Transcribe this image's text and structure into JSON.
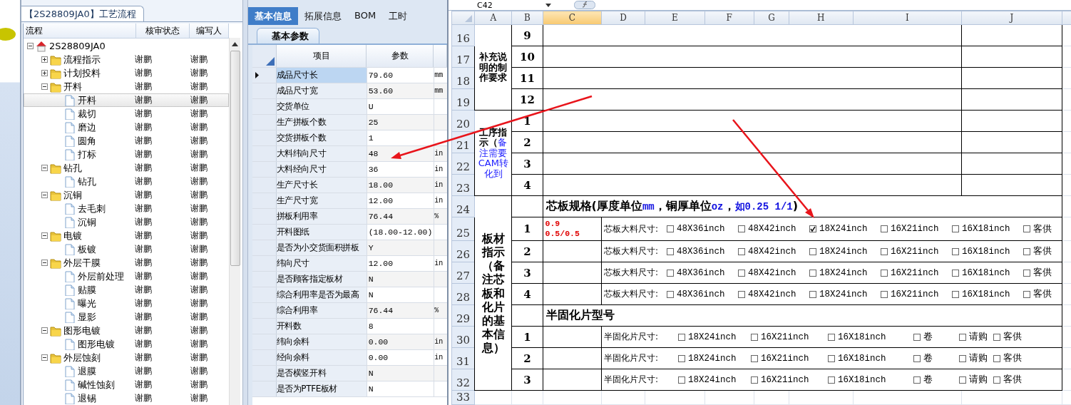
{
  "left_panel": {
    "tab": "【2S28809JA0】工艺流程",
    "columns": [
      "流程",
      "核审状态",
      "编写人"
    ],
    "tree": [
      {
        "label": "2S28809JA0",
        "kind": "root",
        "expanded": true,
        "selected": false,
        "children": [
          {
            "label": "流程指示",
            "kind": "folder",
            "expanded": false,
            "selected": false,
            "status": "谢鹏",
            "author": "谢鹏"
          },
          {
            "label": "计划投料",
            "kind": "folder",
            "expanded": false,
            "selected": false,
            "status": "谢鹏",
            "author": "谢鹏"
          },
          {
            "label": "开料",
            "kind": "folder",
            "expanded": true,
            "selected": false,
            "status": "谢鹏",
            "author": "谢鹏",
            "children": [
              {
                "label": "开料",
                "kind": "file",
                "selected": true,
                "status": "谢鹏",
                "author": "谢鹏"
              },
              {
                "label": "裁切",
                "kind": "file",
                "selected": false,
                "status": "谢鹏",
                "author": "谢鹏"
              },
              {
                "label": "磨边",
                "kind": "file",
                "selected": false,
                "status": "谢鹏",
                "author": "谢鹏"
              },
              {
                "label": "圆角",
                "kind": "file",
                "selected": false,
                "status": "谢鹏",
                "author": "谢鹏"
              },
              {
                "label": "打标",
                "kind": "file",
                "selected": false,
                "status": "谢鹏",
                "author": "谢鹏"
              }
            ]
          },
          {
            "label": "钻孔",
            "kind": "folder",
            "expanded": true,
            "selected": false,
            "status": "谢鹏",
            "author": "谢鹏",
            "children": [
              {
                "label": "钻孔",
                "kind": "file",
                "selected": false,
                "status": "谢鹏",
                "author": "谢鹏"
              }
            ]
          },
          {
            "label": "沉铜",
            "kind": "folder",
            "expanded": true,
            "selected": false,
            "status": "谢鹏",
            "author": "谢鹏",
            "children": [
              {
                "label": "去毛刺",
                "kind": "file",
                "selected": false,
                "status": "谢鹏",
                "author": "谢鹏"
              },
              {
                "label": "沉铜",
                "kind": "file",
                "selected": false,
                "status": "谢鹏",
                "author": "谢鹏"
              }
            ]
          },
          {
            "label": "电镀",
            "kind": "folder",
            "expanded": true,
            "selected": false,
            "status": "谢鹏",
            "author": "谢鹏",
            "children": [
              {
                "label": "板镀",
                "kind": "file",
                "selected": false,
                "status": "谢鹏",
                "author": "谢鹏"
              }
            ]
          },
          {
            "label": "外层干膜",
            "kind": "folder",
            "expanded": true,
            "selected": false,
            "status": "谢鹏",
            "author": "谢鹏",
            "children": [
              {
                "label": "外层前处理",
                "kind": "file",
                "selected": false,
                "status": "谢鹏",
                "author": "谢鹏"
              },
              {
                "label": "贴膜",
                "kind": "file",
                "selected": false,
                "status": "谢鹏",
                "author": "谢鹏"
              },
              {
                "label": "曝光",
                "kind": "file",
                "selected": false,
                "status": "谢鹏",
                "author": "谢鹏"
              },
              {
                "label": "显影",
                "kind": "file",
                "selected": false,
                "status": "谢鹏",
                "author": "谢鹏"
              }
            ]
          },
          {
            "label": "图形电镀",
            "kind": "folder",
            "expanded": true,
            "selected": false,
            "status": "谢鹏",
            "author": "谢鹏",
            "children": [
              {
                "label": "图形电镀",
                "kind": "file",
                "selected": false,
                "status": "谢鹏",
                "author": "谢鹏"
              }
            ]
          },
          {
            "label": "外层蚀刻",
            "kind": "folder",
            "expanded": true,
            "selected": false,
            "status": "谢鹏",
            "author": "谢鹏",
            "children": [
              {
                "label": "退膜",
                "kind": "file",
                "selected": false,
                "status": "谢鹏",
                "author": "谢鹏"
              },
              {
                "label": "碱性蚀刻",
                "kind": "file",
                "selected": false,
                "status": "谢鹏",
                "author": "谢鹏"
              },
              {
                "label": "退锡",
                "kind": "file",
                "selected": false,
                "status": "谢鹏",
                "author": "谢鹏"
              }
            ]
          }
        ]
      }
    ]
  },
  "middle_panel": {
    "tabs": [
      {
        "label": "基本信息",
        "selected": true
      },
      {
        "label": "拓展信息",
        "selected": false
      },
      {
        "label": "BOM",
        "selected": false
      },
      {
        "label": "工时",
        "selected": false
      }
    ],
    "subtab": "基本参数",
    "columns": [
      "项目",
      "参数"
    ],
    "rows": [
      {
        "item": "成品尺寸长",
        "value": "79.60",
        "unit": "mm",
        "selected": true
      },
      {
        "item": "成品尺寸宽",
        "value": "53.60",
        "unit": "mm",
        "selected": false
      },
      {
        "item": "交货单位",
        "value": "U",
        "selected": false
      },
      {
        "item": "生产拼板个数",
        "value": "25",
        "selected": false
      },
      {
        "item": "交货拼板个数",
        "value": "1",
        "selected": false
      },
      {
        "item": "大料纬向尺寸",
        "value": "48",
        "unit": "in",
        "selected": false
      },
      {
        "item": "大料经向尺寸",
        "value": "36",
        "unit": "in",
        "selected": false
      },
      {
        "item": "生产尺寸长",
        "value": "18.00",
        "unit": "in",
        "selected": false
      },
      {
        "item": "生产尺寸宽",
        "value": "12.00",
        "unit": "in",
        "selected": false
      },
      {
        "item": "拼板利用率",
        "value": "76.44",
        "unit": "%",
        "selected": false
      },
      {
        "item": "开料图纸",
        "value": "(18.00-12.00)",
        "selected": false
      },
      {
        "item": "是否为小交货面积拼板",
        "value": "Y",
        "selected": false
      },
      {
        "item": "纬向尺寸",
        "value": "12.00",
        "unit": "in",
        "selected": false
      },
      {
        "item": "是否顾客指定板材",
        "value": "N",
        "selected": false
      },
      {
        "item": "综合利用率是否为最高",
        "value": "N",
        "selected": false
      },
      {
        "item": "综合利用率",
        "value": "76.44",
        "unit": "%",
        "selected": false
      },
      {
        "item": "开料数",
        "value": "8",
        "selected": false
      },
      {
        "item": "纬向余料",
        "value": "0.00",
        "unit": "in",
        "selected": false
      },
      {
        "item": "经向余料",
        "value": "0.00",
        "unit": "in",
        "selected": false
      },
      {
        "item": "是否横竖开料",
        "value": "N",
        "selected": false
      },
      {
        "item": "是否为PTFE板材",
        "value": "N",
        "selected": false
      }
    ]
  },
  "sheet": {
    "name_box": "C42",
    "columns": [
      {
        "label": "A",
        "selected": false
      },
      {
        "label": "B",
        "selected": false
      },
      {
        "label": "C",
        "selected": true
      },
      {
        "label": "D",
        "selected": false
      },
      {
        "label": "E",
        "selected": false
      },
      {
        "label": "F",
        "selected": false
      },
      {
        "label": "G",
        "selected": false
      },
      {
        "label": "H",
        "selected": false
      },
      {
        "label": "I",
        "selected": false
      },
      {
        "label": "J",
        "selected": false
      }
    ],
    "sections": [
      {
        "kind": "notes",
        "label": "补充说明的制作要求",
        "rows": [
          {
            "row": "16",
            "num": "9"
          },
          {
            "row": "17",
            "num": "10"
          },
          {
            "row": "18",
            "num": "11"
          },
          {
            "row": "19",
            "num": "12"
          }
        ]
      },
      {
        "kind": "notes",
        "label": "工序指示（",
        "note": "备注需要CAM转化到",
        "rows": [
          {
            "row": "20",
            "num": "1"
          },
          {
            "row": "21",
            "num": "2"
          },
          {
            "row": "22",
            "num": "3"
          },
          {
            "row": "23",
            "num": "4"
          }
        ]
      },
      {
        "kind": "material",
        "label": "板材指示（备注芯板和化片的基本信息）",
        "rows": [
          {
            "kind": "title",
            "row": "24",
            "segments": [
              {
                "text": "芯板规格(厚度单位",
                "kind": "plain"
              },
              {
                "text": "mm",
                "kind": "note"
              },
              {
                "text": "，铜厚单位",
                "kind": "plain"
              },
              {
                "text": "oz",
                "kind": "note"
              },
              {
                "text": "，",
                "kind": "plain"
              },
              {
                "text": "如0.25 1/1",
                "kind": "note"
              },
              {
                "text": ")",
                "kind": "plain"
              }
            ]
          },
          {
            "kind": "core",
            "row": "25",
            "num": "1",
            "spec": [
              "0.9",
              "0.5/0.5"
            ],
            "field": "芯板大料尺寸:",
            "options": [
              {
                "label": "48X36inch",
                "checked": false
              },
              {
                "label": "48X42inch",
                "checked": false
              },
              {
                "label": "18X24inch",
                "checked": true
              },
              {
                "label": "16X21inch",
                "checked": false
              },
              {
                "label": "16X18inch",
                "checked": false
              },
              {
                "label": "客供",
                "checked": false
              }
            ]
          },
          {
            "kind": "core",
            "row": "26",
            "num": "2",
            "field": "芯板大料尺寸:",
            "options": [
              {
                "label": "48X36inch",
                "checked": false
              },
              {
                "label": "48X42inch",
                "checked": false
              },
              {
                "label": "18X24inch",
                "checked": false
              },
              {
                "label": "16X21inch",
                "checked": false
              },
              {
                "label": "16X18inch",
                "checked": false
              },
              {
                "label": "客供",
                "checked": false
              }
            ]
          },
          {
            "kind": "core",
            "row": "27",
            "num": "3",
            "field": "芯板大料尺寸:",
            "options": [
              {
                "label": "48X36inch",
                "checked": false
              },
              {
                "label": "48X42inch",
                "checked": false
              },
              {
                "label": "18X24inch",
                "checked": false
              },
              {
                "label": "16X21inch",
                "checked": false
              },
              {
                "label": "16X18inch",
                "checked": false
              },
              {
                "label": "客供",
                "checked": false
              }
            ]
          },
          {
            "kind": "core",
            "row": "28",
            "num": "4",
            "field": "芯板大料尺寸:",
            "options": [
              {
                "label": "48X36inch",
                "checked": false
              },
              {
                "label": "48X42inch",
                "checked": false
              },
              {
                "label": "18X24inch",
                "checked": false
              },
              {
                "label": "16X21inch",
                "checked": false
              },
              {
                "label": "16X18inch",
                "checked": false
              },
              {
                "label": "客供",
                "checked": false
              }
            ]
          },
          {
            "kind": "title",
            "row": "29",
            "segments": [
              {
                "text": "半固化片型号",
                "kind": "plain"
              }
            ]
          },
          {
            "kind": "prepreg",
            "row": "30",
            "num": "1",
            "field": "半固化片尺寸:",
            "options": [
              {
                "label": "18X24inch",
                "checked": false
              },
              {
                "label": "16X21inch",
                "checked": false
              },
              {
                "label": "16X18inch",
                "checked": false
              },
              {
                "label": "卷",
                "checked": false
              },
              {
                "label": "请购",
                "checked": false
              },
              {
                "label": "客供",
                "checked": false
              }
            ]
          },
          {
            "kind": "prepreg",
            "row": "31",
            "num": "2",
            "field": "半固化片尺寸:",
            "options": [
              {
                "label": "18X24inch",
                "checked": false
              },
              {
                "label": "16X21inch",
                "checked": false
              },
              {
                "label": "16X18inch",
                "checked": false
              },
              {
                "label": "卷",
                "checked": false
              },
              {
                "label": "请购",
                "checked": false
              },
              {
                "label": "客供",
                "checked": false
              }
            ]
          },
          {
            "kind": "prepreg",
            "row": "32",
            "num": "3",
            "field": "半固化片尺寸:",
            "options": [
              {
                "label": "18X24inch",
                "checked": false
              },
              {
                "label": "16X21inch",
                "checked": false
              },
              {
                "label": "16X18inch",
                "checked": false
              },
              {
                "label": "卷",
                "checked": false
              },
              {
                "label": "请购",
                "checked": false
              },
              {
                "label": "客供",
                "checked": false
              }
            ]
          }
        ]
      }
    ],
    "empty_rows": [
      "33"
    ]
  }
}
